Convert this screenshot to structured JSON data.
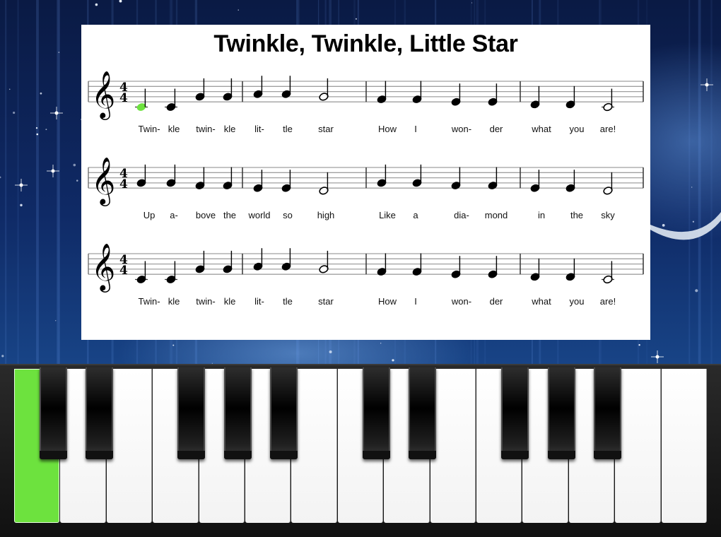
{
  "song": {
    "title": "Twinkle, Twinkle, Little Star",
    "time_signature": {
      "top": "4",
      "bottom": "4"
    },
    "clef": "treble",
    "current_note_index": 0,
    "highlight_color": "#6de23e",
    "rows": [
      {
        "notes": [
          {
            "pitch": "C4",
            "dur": "q",
            "lyric": "Twin-"
          },
          {
            "pitch": "C4",
            "dur": "q",
            "lyric": "kle"
          },
          {
            "pitch": "G4",
            "dur": "q",
            "lyric": "twin-"
          },
          {
            "pitch": "G4",
            "dur": "q",
            "lyric": "kle"
          },
          {
            "pitch": "A4",
            "dur": "q",
            "lyric": "lit-"
          },
          {
            "pitch": "A4",
            "dur": "q",
            "lyric": "tle"
          },
          {
            "pitch": "G4",
            "dur": "h",
            "lyric": "star"
          },
          {
            "pitch": "F4",
            "dur": "q",
            "lyric": "How"
          },
          {
            "pitch": "F4",
            "dur": "q",
            "lyric": "I"
          },
          {
            "pitch": "E4",
            "dur": "q",
            "lyric": "won-"
          },
          {
            "pitch": "E4",
            "dur": "q",
            "lyric": "der"
          },
          {
            "pitch": "D4",
            "dur": "q",
            "lyric": "what"
          },
          {
            "pitch": "D4",
            "dur": "q",
            "lyric": "you"
          },
          {
            "pitch": "C4",
            "dur": "h",
            "lyric": "are!"
          }
        ]
      },
      {
        "notes": [
          {
            "pitch": "G4",
            "dur": "q",
            "lyric": "Up"
          },
          {
            "pitch": "G4",
            "dur": "q",
            "lyric": "a-"
          },
          {
            "pitch": "F4",
            "dur": "q",
            "lyric": "bove"
          },
          {
            "pitch": "F4",
            "dur": "q",
            "lyric": "the"
          },
          {
            "pitch": "E4",
            "dur": "q",
            "lyric": "world"
          },
          {
            "pitch": "E4",
            "dur": "q",
            "lyric": "so"
          },
          {
            "pitch": "D4",
            "dur": "h",
            "lyric": "high"
          },
          {
            "pitch": "G4",
            "dur": "q",
            "lyric": "Like"
          },
          {
            "pitch": "G4",
            "dur": "q",
            "lyric": "a"
          },
          {
            "pitch": "F4",
            "dur": "q",
            "lyric": "dia-"
          },
          {
            "pitch": "F4",
            "dur": "q",
            "lyric": "mond"
          },
          {
            "pitch": "E4",
            "dur": "q",
            "lyric": "in"
          },
          {
            "pitch": "E4",
            "dur": "q",
            "lyric": "the"
          },
          {
            "pitch": "D4",
            "dur": "h",
            "lyric": "sky"
          }
        ]
      },
      {
        "notes": [
          {
            "pitch": "C4",
            "dur": "q",
            "lyric": "Twin-"
          },
          {
            "pitch": "C4",
            "dur": "q",
            "lyric": "kle"
          },
          {
            "pitch": "G4",
            "dur": "q",
            "lyric": "twin-"
          },
          {
            "pitch": "G4",
            "dur": "q",
            "lyric": "kle"
          },
          {
            "pitch": "A4",
            "dur": "q",
            "lyric": "lit-"
          },
          {
            "pitch": "A4",
            "dur": "q",
            "lyric": "tle"
          },
          {
            "pitch": "G4",
            "dur": "h",
            "lyric": "star"
          },
          {
            "pitch": "F4",
            "dur": "q",
            "lyric": "How"
          },
          {
            "pitch": "F4",
            "dur": "q",
            "lyric": "I"
          },
          {
            "pitch": "E4",
            "dur": "q",
            "lyric": "won-"
          },
          {
            "pitch": "E4",
            "dur": "q",
            "lyric": "der"
          },
          {
            "pitch": "D4",
            "dur": "q",
            "lyric": "what"
          },
          {
            "pitch": "D4",
            "dur": "q",
            "lyric": "you"
          },
          {
            "pitch": "C4",
            "dur": "h",
            "lyric": "are!"
          }
        ]
      }
    ]
  },
  "keyboard": {
    "white_keys": [
      "C4",
      "D4",
      "E4",
      "F4",
      "G4",
      "A4",
      "B4",
      "C5",
      "D5",
      "E5",
      "F5",
      "G5",
      "A5",
      "B5",
      "C6"
    ],
    "black_keys": [
      "C#4",
      "D#4",
      "F#4",
      "G#4",
      "A#4",
      "C#5",
      "D#5",
      "F#5",
      "G#5",
      "A#5"
    ],
    "active_key": "C4"
  }
}
